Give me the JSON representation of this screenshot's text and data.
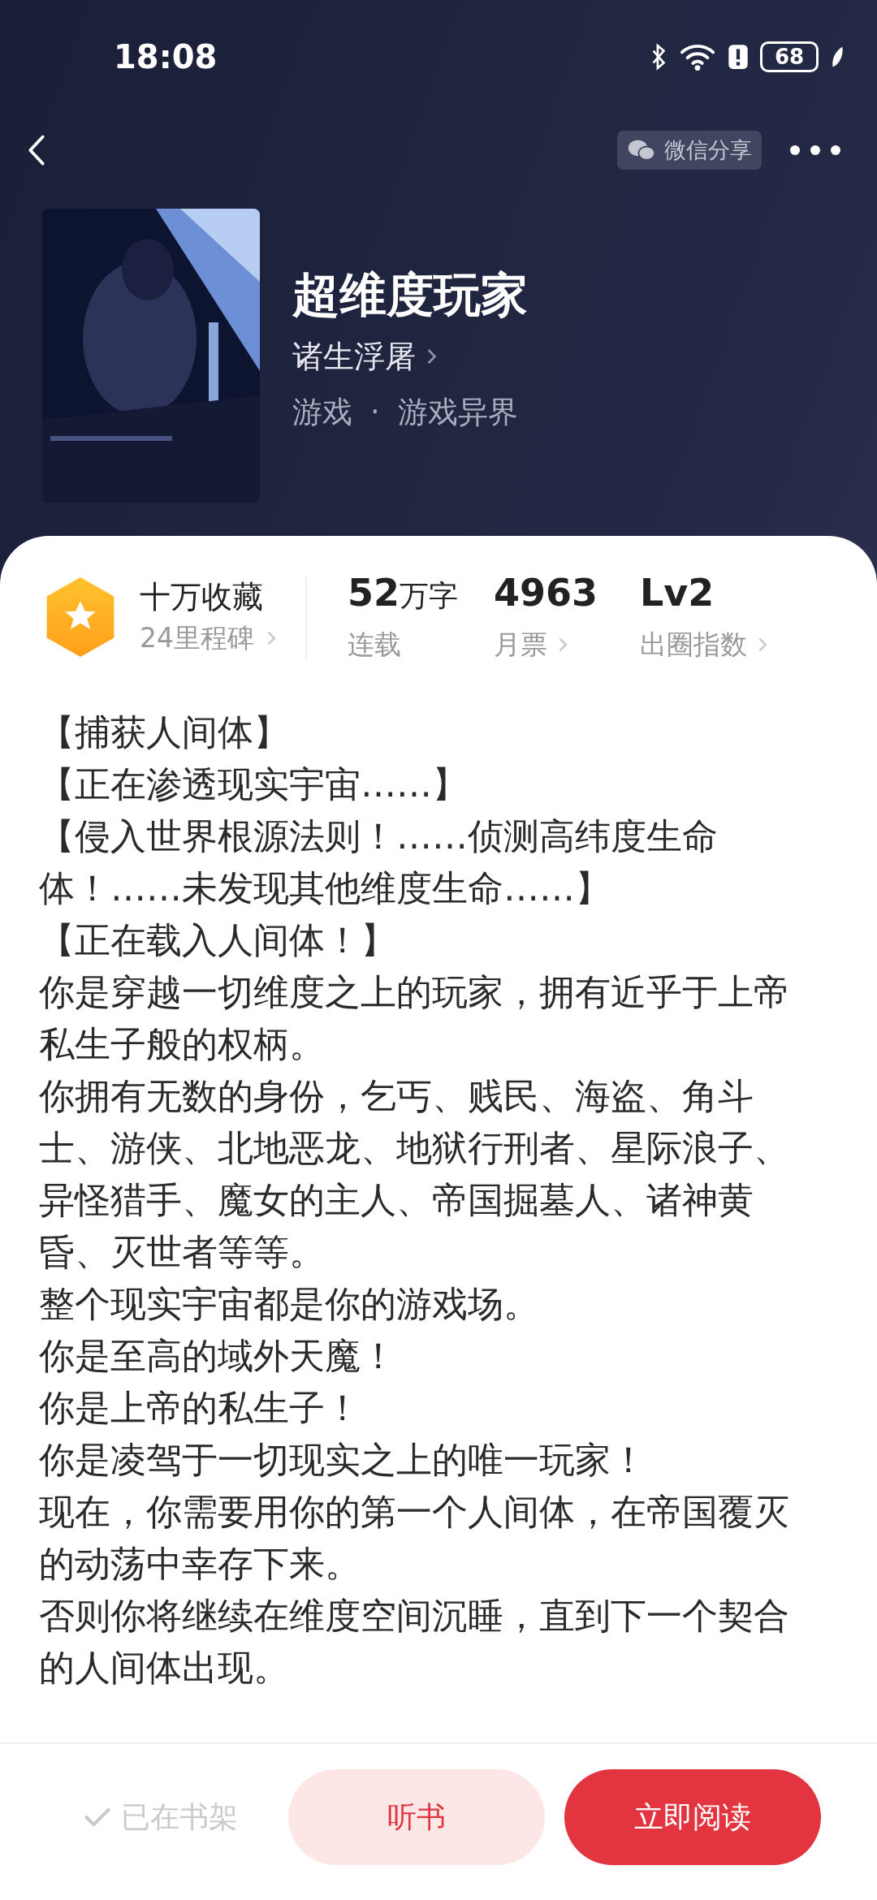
{
  "status_bar": {
    "time": "18:08",
    "battery": "68"
  },
  "nav": {
    "share_label": "微信分享"
  },
  "book": {
    "title": "超维度玩家",
    "author": "诸生浮屠",
    "genre": "游戏",
    "separator": "·",
    "subgenre": "游戏异界"
  },
  "stats": [
    {
      "kind": "badge",
      "value": "十万收藏",
      "label": "24里程碑",
      "link": true
    },
    {
      "kind": "count",
      "value": "52",
      "unit": "万字",
      "label": "连载",
      "link": false
    },
    {
      "kind": "count",
      "value": "4963",
      "label": "月票",
      "link": true
    },
    {
      "kind": "count",
      "value": "Lv2",
      "label": "出圈指数",
      "link": true
    }
  ],
  "description": [
    "【捕获人间体】",
    "【正在渗透现实宇宙……】",
    "【侵入世界根源法则！……侦测高纬度生命体！……未发现其他维度生命……】",
    "【正在载入人间体！】",
    "你是穿越一切维度之上的玩家，拥有近乎于上帝私生子般的权柄。",
    "你拥有无数的身份，乞丐、贱民、海盗、角斗士、游侠、北地恶龙、地狱行刑者、星际浪子、异怪猎手、魔女的主人、帝国掘墓人、诸神黄昏、灭世者等等。",
    "整个现实宇宙都是你的游戏场。",
    "你是至高的域外天魔！",
    "你是上帝的私生子！",
    "你是凌驾于一切现实之上的唯一玩家！",
    "现在，你需要用你的第一个人间体，在帝国覆灭的动荡中幸存下来。",
    "否则你将继续在维度空间沉睡，直到下一个契合的人间体出现。"
  ],
  "actions": {
    "shelf": {
      "label": "已在书架",
      "checked": true
    },
    "listen": "听书",
    "read": "立即阅读"
  }
}
